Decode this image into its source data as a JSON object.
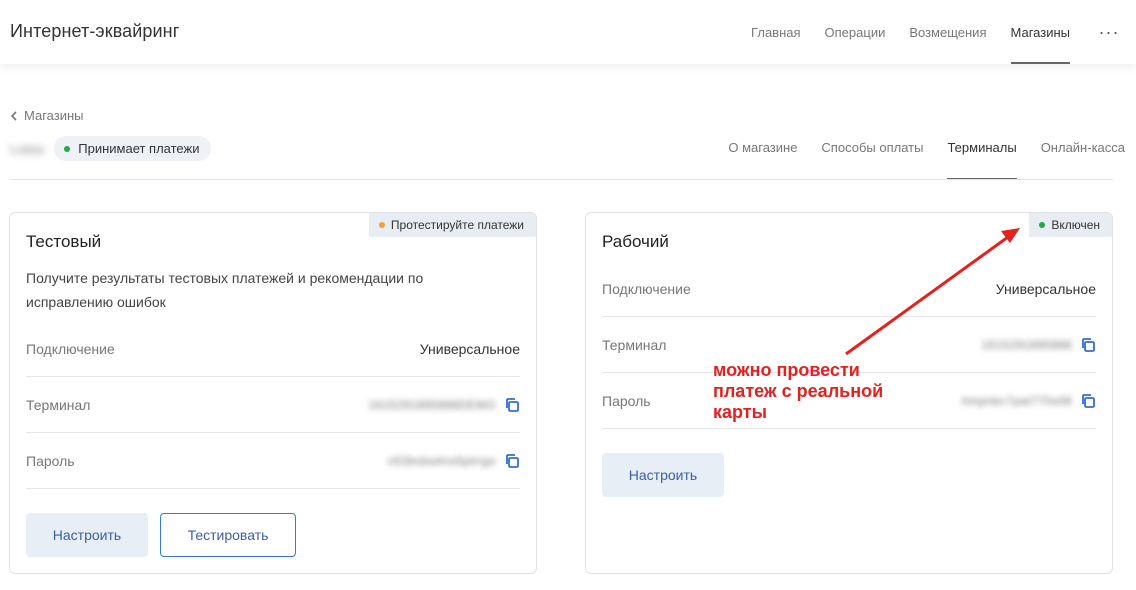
{
  "header": {
    "app_title": "Интернет-эквайринг",
    "nav": [
      "Главная",
      "Операции",
      "Возмещения",
      "Магазины"
    ],
    "active_nav": "Магазины",
    "more_label": "···"
  },
  "breadcrumb": {
    "back_label": "Магазины"
  },
  "shop": {
    "name": "Lotos",
    "status": "Принимает платежи",
    "status_color": "#22a845"
  },
  "tabs": {
    "items": [
      "О магазине",
      "Способы оплаты",
      "Терминалы",
      "Онлайн-касса"
    ],
    "active": "Терминалы"
  },
  "test_terminal": {
    "badge": "Протестируйте платежи",
    "badge_color": "#f0a040",
    "title": "Тестовый",
    "description": "Получите результаты тестовых платежей и рекомендации по исправлению ошибок",
    "rows": {
      "connection_label": "Подключение",
      "connection_value": "Универсальное",
      "terminal_label": "Терминал",
      "terminal_value": "1615291895888DEMO",
      "password_label": "Пароль",
      "password_value": "n53bsba4nx5ptrrgo"
    },
    "configure_label": "Настроить",
    "test_label": "Тестировать"
  },
  "live_terminal": {
    "badge": "Включен",
    "badge_color": "#22a845",
    "title": "Рабочий",
    "rows": {
      "connection_label": "Подключение",
      "connection_value": "Универсальное",
      "terminal_label": "Терминал",
      "terminal_value": "1615291895888",
      "password_label": "Пароль",
      "password_value": "hmpnbc7pat770s08"
    },
    "configure_label": "Настроить"
  },
  "annotation": {
    "text_line1": "можно провести",
    "text_line2": "платеж с реальной",
    "text_line3": "карты",
    "color": "#e5201d"
  },
  "icons": {
    "back": "chevron-left-icon",
    "copy": "copy-icon",
    "more": "more-horizontal-icon"
  }
}
